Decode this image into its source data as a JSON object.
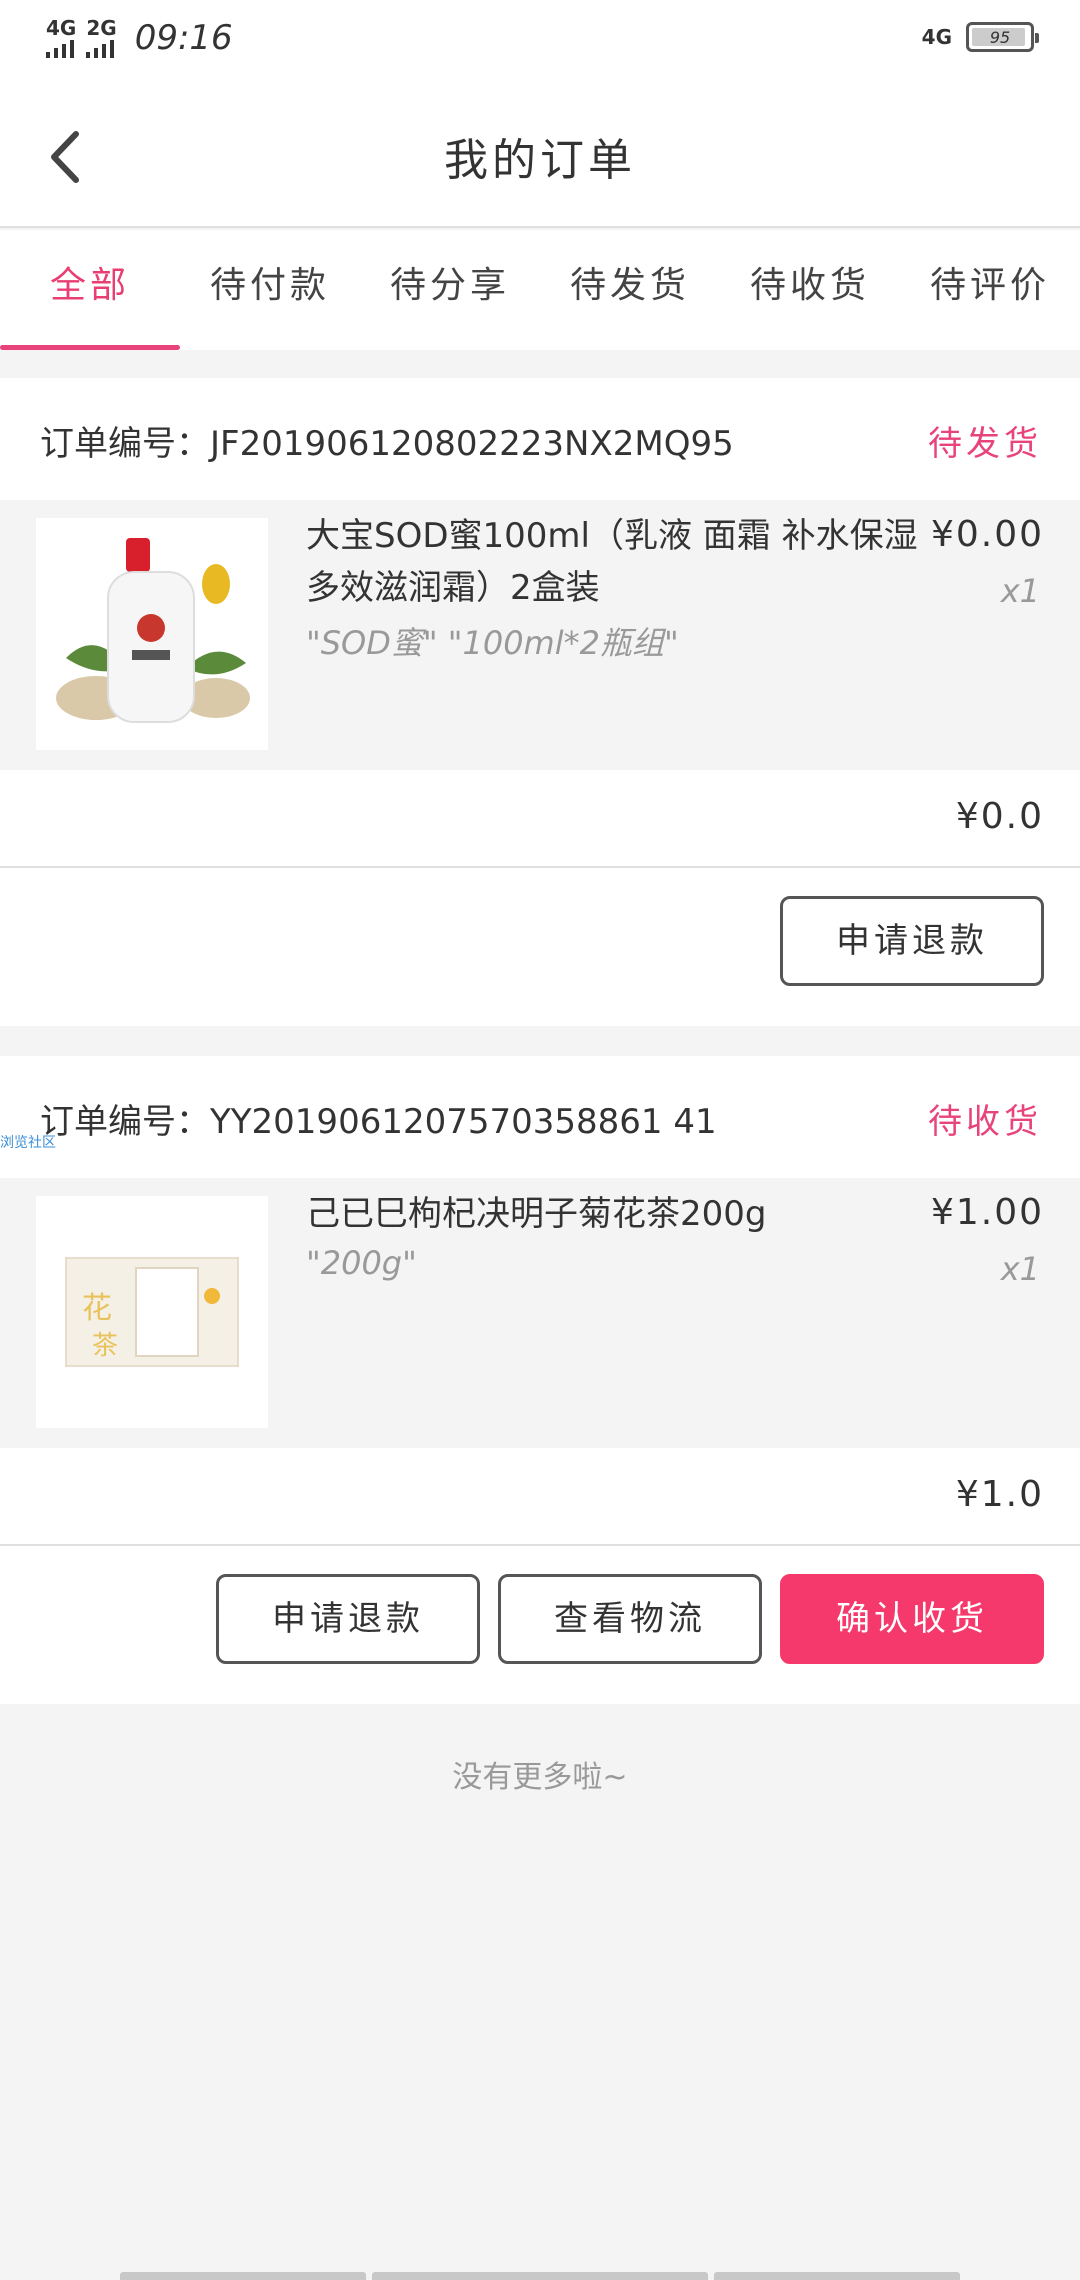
{
  "status_bar": {
    "net1": "4G",
    "net2": "2G",
    "time": "09:16",
    "net_right": "4G",
    "battery": "95",
    "battery_level": 0.95
  },
  "header": {
    "title": "我的订单"
  },
  "tabs": [
    {
      "label": "全部"
    },
    {
      "label": "待付款"
    },
    {
      "label": "待分享"
    },
    {
      "label": "待发货"
    },
    {
      "label": "待收货"
    },
    {
      "label": "待评价"
    }
  ],
  "active_tab": 0,
  "orders": [
    {
      "order_no_label": "订单编号：",
      "order_no": "JF201906120802223NX2MQ95",
      "status": "待发货",
      "item": {
        "name": "大宝SOD蜜100ml（乳液 面霜 补水保湿 多效滋润霜）2盒装",
        "spec": "\"SOD蜜\" \"100ml*2瓶组\"",
        "price": "¥0.00",
        "qty": "x1"
      },
      "total": "¥0.0",
      "buttons": [
        "申请退款"
      ]
    },
    {
      "order_no_label": "订单编号：",
      "order_no": "YY2019061207570358861 41",
      "status": "待收货",
      "item": {
        "name": "己已巳枸杞决明子菊花茶200g",
        "spec": "\"200g\"",
        "price": "¥1.00",
        "qty": "x1"
      },
      "total": "¥1.0",
      "buttons": [
        "申请退款",
        "查看物流",
        "确认收货"
      ]
    }
  ],
  "overlay_label": "浏览社区",
  "footer": {
    "no_more": "没有更多啦~"
  },
  "colors": {
    "accent": "#e8437a",
    "primary_button": "#f5396c"
  }
}
